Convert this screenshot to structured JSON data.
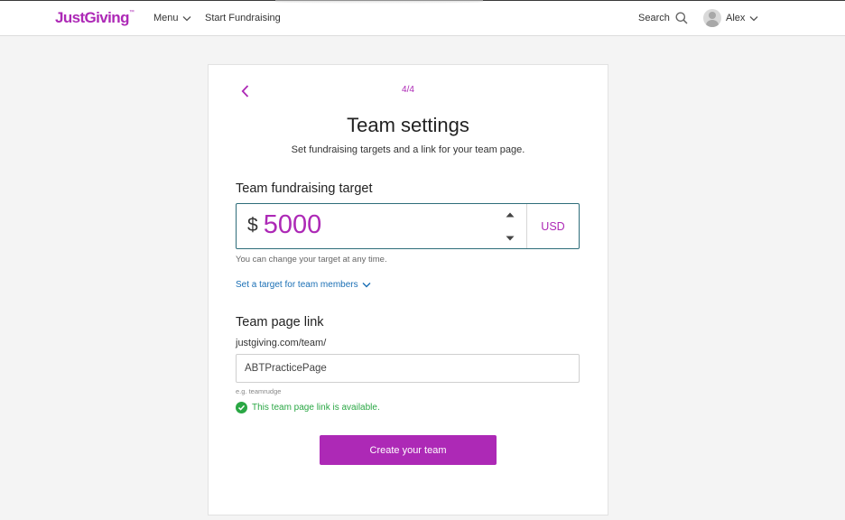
{
  "header": {
    "logo_text": "JustGiving",
    "logo_mark": "™",
    "menu_label": "Menu",
    "start_label": "Start Fundraising",
    "search_label": "Search",
    "user_name": "Alex"
  },
  "card": {
    "step": "4/4",
    "title": "Team settings",
    "subtitle": "Set fundraising targets and a link for your team page.",
    "target": {
      "label": "Team fundraising target",
      "currency_symbol": "$",
      "value": "5000",
      "currency_code": "USD",
      "hint": "You can change your target at any time.",
      "members_link": "Set a target for team members"
    },
    "link": {
      "label": "Team page link",
      "prefix": "justgiving.com/team/",
      "value": "ABTPracticePage",
      "example": "e.g. teamrudge",
      "status": "This team page link is available."
    },
    "submit_label": "Create your team"
  },
  "colors": {
    "brand": "#ad29b6",
    "link": "#1a6fb5",
    "success": "#2aa744"
  }
}
